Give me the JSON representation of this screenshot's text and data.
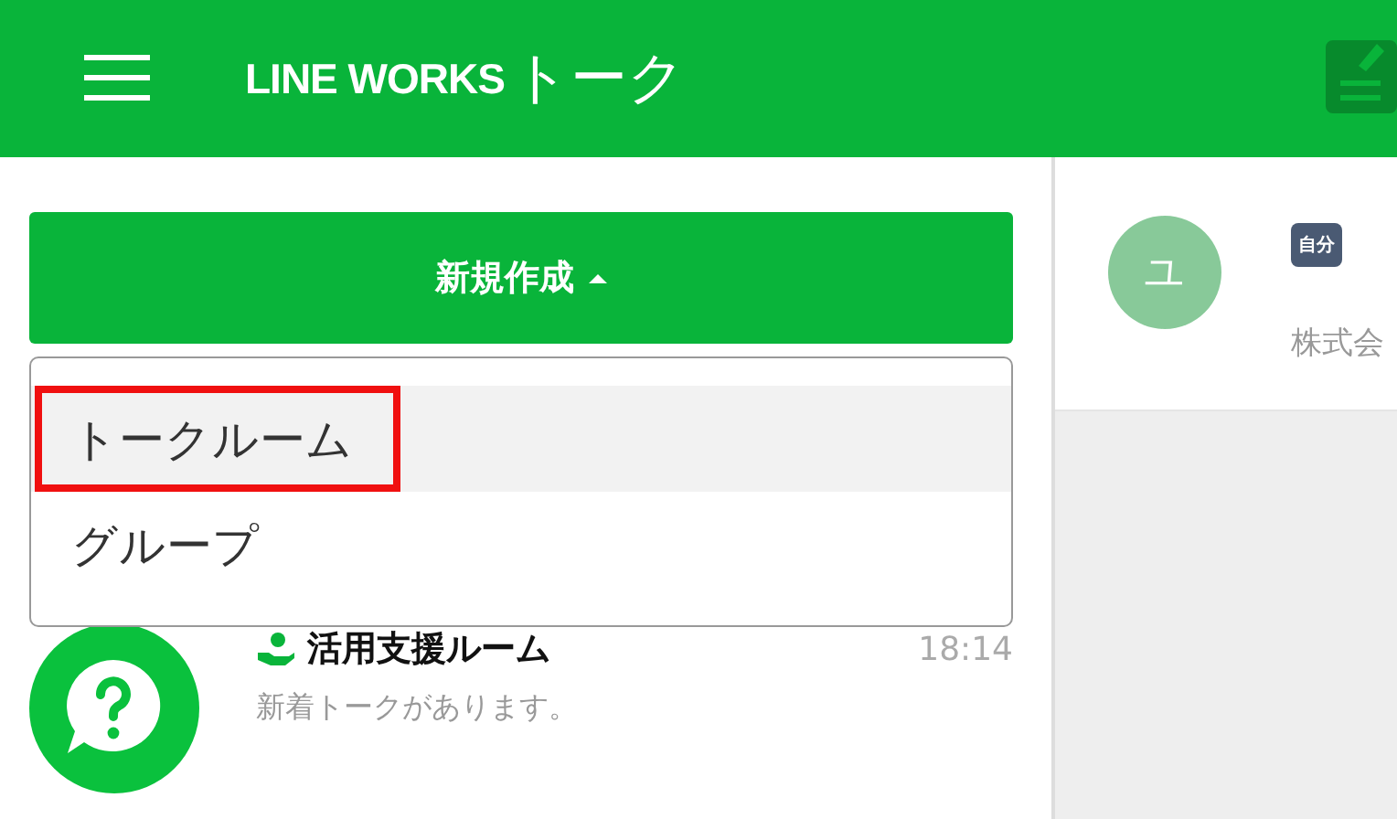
{
  "header": {
    "brand": "LINE WORKS",
    "title": "トーク"
  },
  "new_button": {
    "label": "新規作成",
    "expanded": true
  },
  "menu": {
    "items": [
      {
        "label": "トークルーム",
        "selected": true,
        "highlighted": true
      },
      {
        "label": "グループ",
        "selected": false,
        "highlighted": false
      }
    ]
  },
  "chats": [
    {
      "name": "活用支援ルーム",
      "time": "18:14",
      "preview": "新着トークがあります。"
    }
  ],
  "profile": {
    "initial": "ユ",
    "badge": "自分",
    "company": "株式会"
  }
}
